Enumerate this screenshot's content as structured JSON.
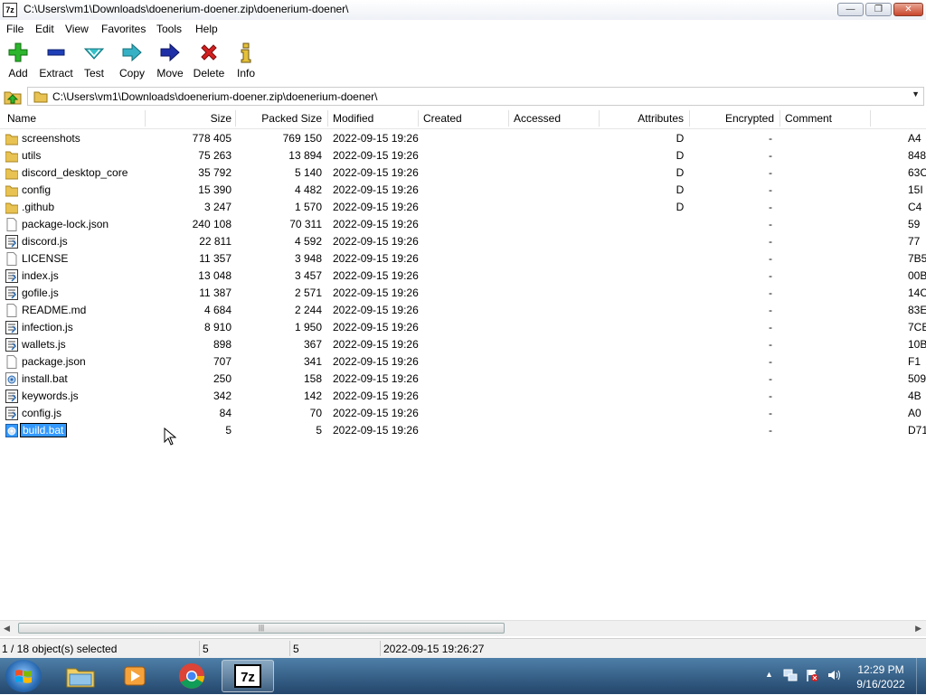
{
  "window": {
    "title": "C:\\Users\\vm1\\Downloads\\doenerium-doener.zip\\doenerium-doener\\",
    "app_icon_text": "7z",
    "controls": {
      "minimize": "—",
      "maximize": "❐",
      "close": "✕"
    }
  },
  "menu": [
    "File",
    "Edit",
    "View",
    "Favorites",
    "Tools",
    "Help"
  ],
  "toolbar": [
    {
      "label": "Add",
      "icon": "plus-icon",
      "color": "#2db52d"
    },
    {
      "label": "Extract",
      "icon": "minus-icon",
      "color": "#1f3fb8"
    },
    {
      "label": "Test",
      "icon": "check-icon",
      "color": "#2aa7b8"
    },
    {
      "label": "Copy",
      "icon": "copy-arrow-icon",
      "color": "#2aa7b8"
    },
    {
      "label": "Move",
      "icon": "move-arrow-icon",
      "color": "#1f2fa8"
    },
    {
      "label": "Delete",
      "icon": "delete-x-icon",
      "color": "#d42020"
    },
    {
      "label": "Info",
      "icon": "info-icon",
      "color": "#c8a21a"
    }
  ],
  "address": {
    "path": "C:\\Users\\vm1\\Downloads\\doenerium-doener.zip\\doenerium-doener\\"
  },
  "columns": [
    "Name",
    "Size",
    "Packed Size",
    "Modified",
    "Created",
    "Accessed",
    "Attributes",
    "Encrypted",
    "Comment"
  ],
  "files": [
    {
      "name": "screenshots",
      "type": "folder",
      "size": "778 405",
      "packed": "769 150",
      "modified": "2022-09-15 19:26",
      "attr": "D",
      "enc": "-",
      "crc": "A4"
    },
    {
      "name": "utils",
      "type": "folder",
      "size": "75 263",
      "packed": "13 894",
      "modified": "2022-09-15 19:26",
      "attr": "D",
      "enc": "-",
      "crc": "848"
    },
    {
      "name": "discord_desktop_core",
      "type": "folder",
      "size": "35 792",
      "packed": "5 140",
      "modified": "2022-09-15 19:26",
      "attr": "D",
      "enc": "-",
      "crc": "63C"
    },
    {
      "name": "config",
      "type": "folder",
      "size": "15 390",
      "packed": "4 482",
      "modified": "2022-09-15 19:26",
      "attr": "D",
      "enc": "-",
      "crc": "15I"
    },
    {
      "name": ".github",
      "type": "folder",
      "size": "3 247",
      "packed": "1 570",
      "modified": "2022-09-15 19:26",
      "attr": "D",
      "enc": "-",
      "crc": "C4"
    },
    {
      "name": "package-lock.json",
      "type": "file",
      "size": "240 108",
      "packed": "70 311",
      "modified": "2022-09-15 19:26",
      "attr": "",
      "enc": "-",
      "crc": "59"
    },
    {
      "name": "discord.js",
      "type": "script",
      "size": "22 811",
      "packed": "4 592",
      "modified": "2022-09-15 19:26",
      "attr": "",
      "enc": "-",
      "crc": "77"
    },
    {
      "name": "LICENSE",
      "type": "file",
      "size": "11 357",
      "packed": "3 948",
      "modified": "2022-09-15 19:26",
      "attr": "",
      "enc": "-",
      "crc": "7B5"
    },
    {
      "name": "index.js",
      "type": "script",
      "size": "13 048",
      "packed": "3 457",
      "modified": "2022-09-15 19:26",
      "attr": "",
      "enc": "-",
      "crc": "00B"
    },
    {
      "name": "gofile.js",
      "type": "script",
      "size": "11 387",
      "packed": "2 571",
      "modified": "2022-09-15 19:26",
      "attr": "",
      "enc": "-",
      "crc": "14C"
    },
    {
      "name": "README.md",
      "type": "file",
      "size": "4 684",
      "packed": "2 244",
      "modified": "2022-09-15 19:26",
      "attr": "",
      "enc": "-",
      "crc": "83E"
    },
    {
      "name": "infection.js",
      "type": "script",
      "size": "8 910",
      "packed": "1 950",
      "modified": "2022-09-15 19:26",
      "attr": "",
      "enc": "-",
      "crc": "7CE"
    },
    {
      "name": "wallets.js",
      "type": "script",
      "size": "898",
      "packed": "367",
      "modified": "2022-09-15 19:26",
      "attr": "",
      "enc": "-",
      "crc": "10B"
    },
    {
      "name": "package.json",
      "type": "file",
      "size": "707",
      "packed": "341",
      "modified": "2022-09-15 19:26",
      "attr": "",
      "enc": "-",
      "crc": "F1"
    },
    {
      "name": "install.bat",
      "type": "batch",
      "size": "250",
      "packed": "158",
      "modified": "2022-09-15 19:26",
      "attr": "",
      "enc": "-",
      "crc": "509"
    },
    {
      "name": "keywords.js",
      "type": "script",
      "size": "342",
      "packed": "142",
      "modified": "2022-09-15 19:26",
      "attr": "",
      "enc": "-",
      "crc": "4B"
    },
    {
      "name": "config.js",
      "type": "script",
      "size": "84",
      "packed": "70",
      "modified": "2022-09-15 19:26",
      "attr": "",
      "enc": "-",
      "crc": "A0"
    },
    {
      "name": "build.bat",
      "type": "batch",
      "size": "5",
      "packed": "5",
      "modified": "2022-09-15 19:26",
      "attr": "",
      "enc": "-",
      "crc": "D71",
      "selected": true
    }
  ],
  "status": {
    "selection": "1 / 18 object(s) selected",
    "size": "5",
    "packed": "5",
    "modified": "2022-09-15 19:26:27"
  },
  "taskbar": {
    "apps": [
      "windows-explorer",
      "media-player",
      "chrome",
      "7-zip"
    ],
    "active": "7-zip",
    "app_7zip_text": "7z",
    "time": "12:29 PM",
    "date": "9/16/2022"
  }
}
